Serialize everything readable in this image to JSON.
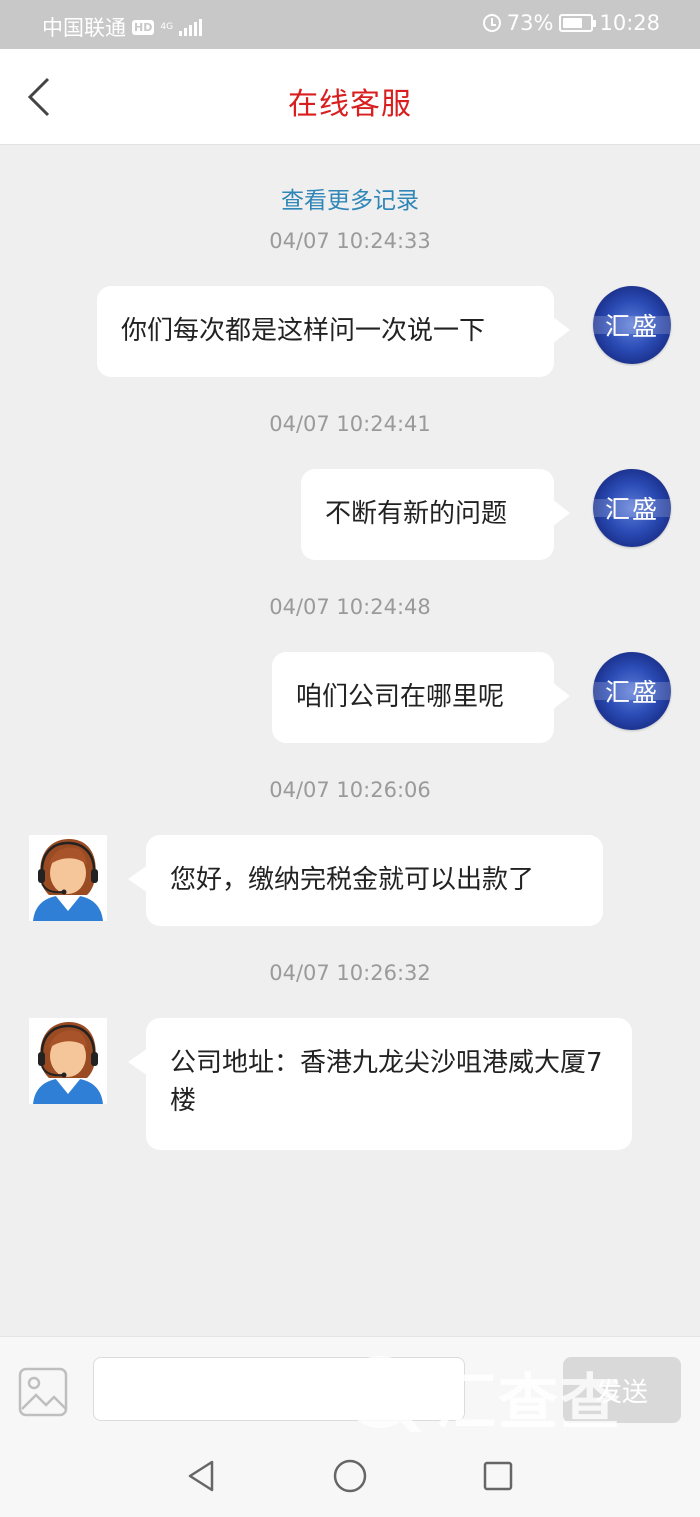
{
  "status_bar": {
    "carrier": "中国联通",
    "hd": "HD",
    "network": "4G",
    "battery": "73%",
    "time": "10:28"
  },
  "header": {
    "title": "在线客服"
  },
  "chat": {
    "load_more": "查看更多记录",
    "avatar_text": "汇盛",
    "messages": [
      {
        "time": "04/07 10:24:33",
        "side": "out",
        "text": "你们每次都是这样问一次说一下"
      },
      {
        "time": "04/07 10:24:41",
        "side": "out",
        "text": "不断有新的问题"
      },
      {
        "time": "04/07 10:24:48",
        "side": "out",
        "text": "咱们公司在哪里呢"
      },
      {
        "time": "04/07 10:26:06",
        "side": "in",
        "text": "您好，缴纳完税金就可以出款了"
      },
      {
        "time": "04/07 10:26:32",
        "side": "in",
        "text": "公司地址：香港九龙尖沙咀港威大厦7楼"
      }
    ]
  },
  "input_bar": {
    "value": "",
    "send_label": "发送",
    "watermark": "汇查查"
  },
  "colors": {
    "title": "#d81e1e",
    "link": "#2f86b7",
    "background": "#efeff0"
  }
}
